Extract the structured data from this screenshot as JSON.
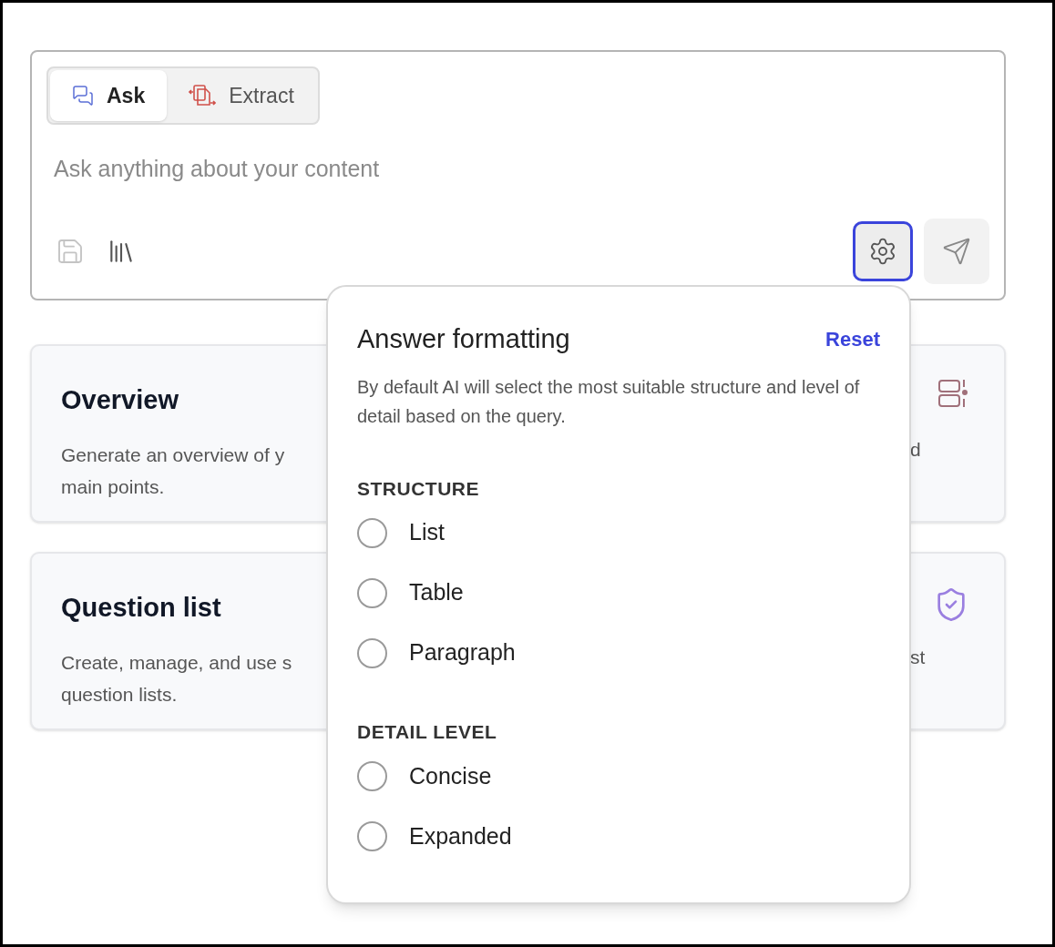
{
  "composer": {
    "tabs": [
      {
        "label": "Ask",
        "selected": true
      },
      {
        "label": "Extract",
        "selected": false
      }
    ],
    "placeholder": "Ask anything about your content",
    "settings_open": true
  },
  "cards": [
    {
      "title": "Overview",
      "visible_text": [
        "Generate an overview of y",
        "main points."
      ],
      "tail": "d"
    },
    {
      "title": "Question list",
      "visible_text": [
        "Create, manage, and use s",
        "question lists."
      ],
      "tail": "st"
    }
  ],
  "popover": {
    "title": "Answer formatting",
    "reset": "Reset",
    "description": "By default AI will select the most suitable structure and level of detail based on the query.",
    "sections": [
      {
        "heading": "STRUCTURE",
        "options": [
          {
            "label": "List",
            "selected": false
          },
          {
            "label": "Table",
            "selected": false
          },
          {
            "label": "Paragraph",
            "selected": false
          }
        ]
      },
      {
        "heading": "DETAIL LEVEL",
        "options": [
          {
            "label": "Concise",
            "selected": false
          },
          {
            "label": "Expanded",
            "selected": false
          }
        ]
      }
    ]
  }
}
